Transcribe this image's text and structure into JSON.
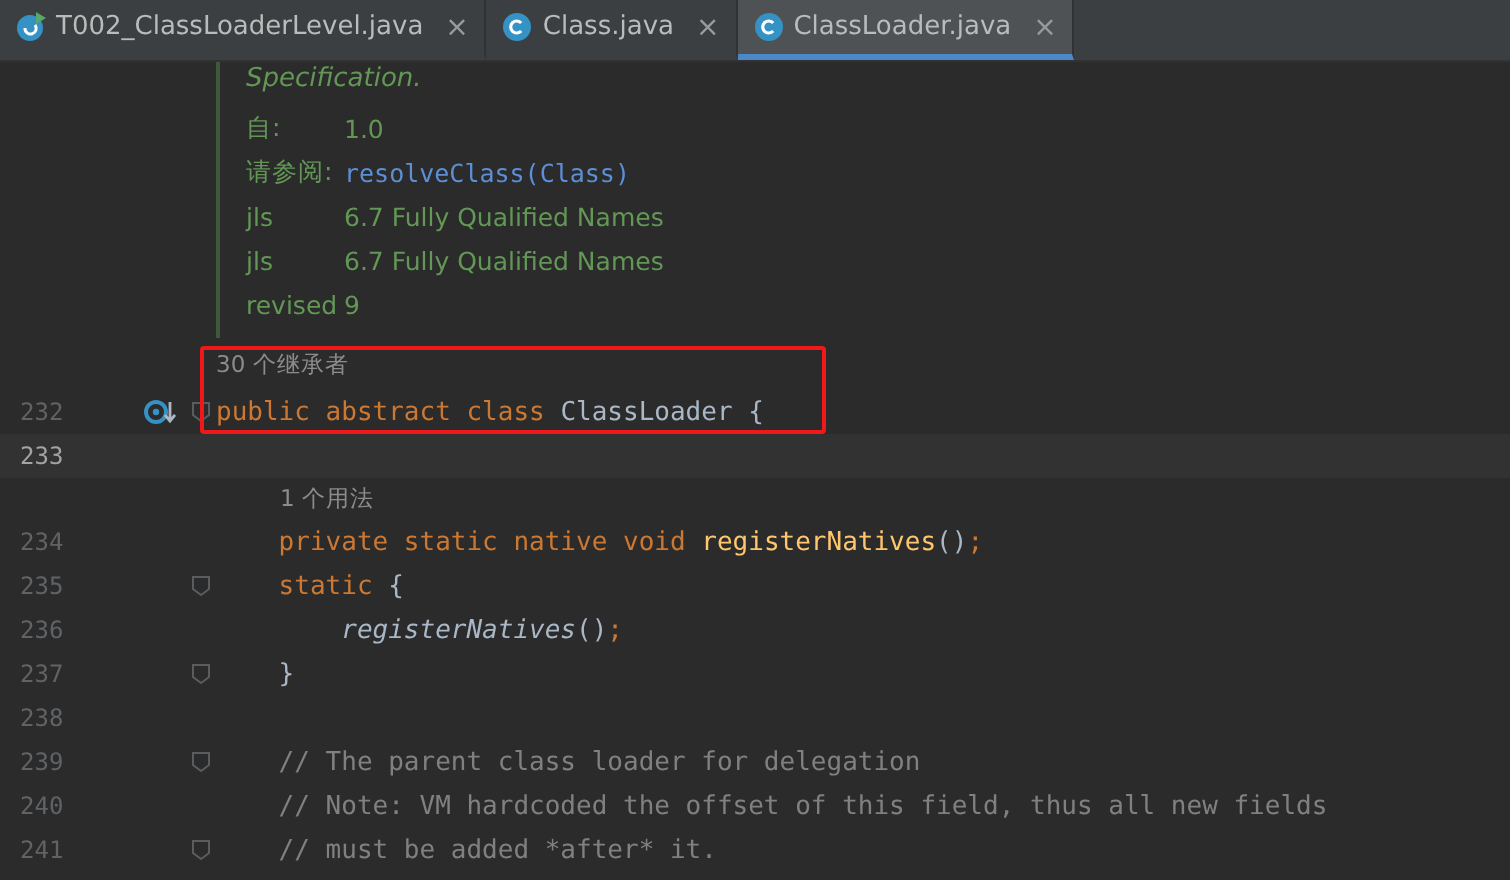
{
  "tabs": [
    {
      "name": "T002_ClassLoaderLevel.java",
      "selected": false,
      "kind": "runnable",
      "closable": true
    },
    {
      "name": "Class.java",
      "selected": false,
      "kind": "library",
      "closable": true
    },
    {
      "name": "ClassLoader.java",
      "selected": true,
      "kind": "library",
      "closable": true
    }
  ],
  "close_glyph": "×",
  "doc": {
    "intro": "Specification.",
    "entries": [
      {
        "label": "自:",
        "value": "1.0",
        "kind": "text"
      },
      {
        "label": "请参阅:",
        "value": "resolveClass(Class)",
        "kind": "link"
      },
      {
        "label": "jls",
        "value": "6.7 Fully Qualified Names",
        "kind": "text"
      },
      {
        "label": "jls",
        "value": "6.7 Fully Qualified Names",
        "kind": "text"
      },
      {
        "label": "revised",
        "value": "9",
        "kind": "text"
      }
    ]
  },
  "lines": [
    {
      "kind": "hint",
      "text": "30 个继承者"
    },
    {
      "kind": "code",
      "number": "232",
      "current": false,
      "annotated": true,
      "fold": true,
      "gutter_icon": true,
      "tokens": [
        {
          "kind": "keyword",
          "text": "public abstract class "
        },
        {
          "kind": "plain",
          "text": "ClassLoader {"
        }
      ]
    },
    {
      "kind": "code",
      "number": "233",
      "current": true,
      "annotated": false,
      "fold": false,
      "gutter_icon": false
    },
    {
      "kind": "hint",
      "text": "1 个用法"
    },
    {
      "kind": "code",
      "number": "234",
      "current": false,
      "annotated": false,
      "fold": false,
      "gutter_icon": false,
      "tokens": [
        {
          "kind": "keyword",
          "text": "    private static native void "
        },
        {
          "kind": "method",
          "text": "registerNatives"
        },
        {
          "kind": "plain",
          "text": "()"
        },
        {
          "kind": "keyword",
          "text": ";"
        }
      ]
    },
    {
      "kind": "code",
      "number": "235",
      "current": false,
      "annotated": false,
      "fold": true,
      "gutter_icon": false,
      "tokens": [
        {
          "kind": "keyword",
          "text": "    static "
        },
        {
          "kind": "plain",
          "text": "{"
        }
      ]
    },
    {
      "kind": "code",
      "number": "236",
      "current": false,
      "annotated": false,
      "fold": false,
      "gutter_icon": false,
      "tokens": [
        {
          "kind": "call",
          "text": "        registerNatives"
        },
        {
          "kind": "plain",
          "text": "()"
        },
        {
          "kind": "keyword",
          "text": ";"
        }
      ]
    },
    {
      "kind": "code",
      "number": "237",
      "current": false,
      "annotated": false,
      "fold": true,
      "gutter_icon": false,
      "tokens": [
        {
          "kind": "plain",
          "text": "    }"
        }
      ]
    },
    {
      "kind": "code",
      "number": "238",
      "current": false,
      "annotated": false,
      "fold": false,
      "gutter_icon": false
    },
    {
      "kind": "code",
      "number": "239",
      "current": false,
      "annotated": false,
      "fold": true,
      "gutter_icon": false,
      "tokens": [
        {
          "kind": "comment",
          "text": "    // The parent class loader for delegation"
        }
      ]
    },
    {
      "kind": "code",
      "number": "240",
      "current": false,
      "annotated": false,
      "fold": false,
      "gutter_icon": false,
      "tokens": [
        {
          "kind": "comment",
          "text": "    // Note: VM hardcoded the offset of this field, thus all new fields"
        }
      ]
    },
    {
      "kind": "code",
      "number": "241",
      "current": false,
      "annotated": false,
      "fold": true,
      "gutter_icon": false,
      "tokens": [
        {
          "kind": "comment",
          "text": "    // must be added *after* it."
        }
      ]
    }
  ]
}
